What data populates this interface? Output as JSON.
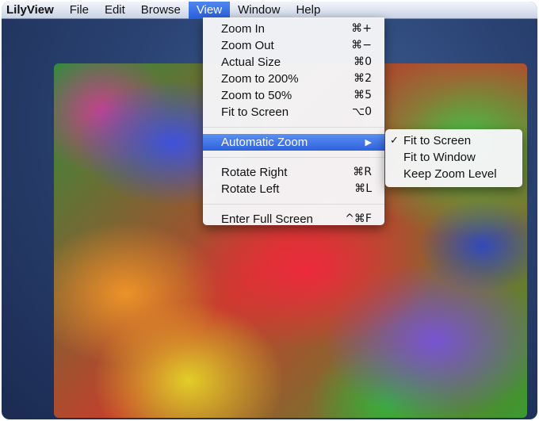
{
  "menubar": {
    "app": "LilyView",
    "items": [
      "File",
      "Edit",
      "Browse",
      "View",
      "Window",
      "Help"
    ]
  },
  "view_menu": {
    "items": [
      {
        "label": "Zoom In",
        "shortcut": "⌘+"
      },
      {
        "label": "Zoom Out",
        "shortcut": "⌘−"
      },
      {
        "label": "Actual Size",
        "shortcut": "⌘0"
      },
      {
        "label": "Zoom to 200%",
        "shortcut": "⌘2"
      },
      {
        "label": "Zoom to 50%",
        "shortcut": "⌘5"
      },
      {
        "label": "Fit to Screen",
        "shortcut": "⌥0"
      },
      {
        "label": "Automatic Zoom",
        "shortcut": "▶"
      },
      {
        "label": "Rotate Right",
        "shortcut": "⌘R"
      },
      {
        "label": "Rotate Left",
        "shortcut": "⌘L"
      },
      {
        "label": "Enter Full Screen",
        "shortcut": "^⌘F"
      }
    ]
  },
  "submenu": {
    "check": "✓",
    "items": [
      "Fit to Screen",
      "Fit to Window",
      "Keep Zoom Level"
    ]
  }
}
